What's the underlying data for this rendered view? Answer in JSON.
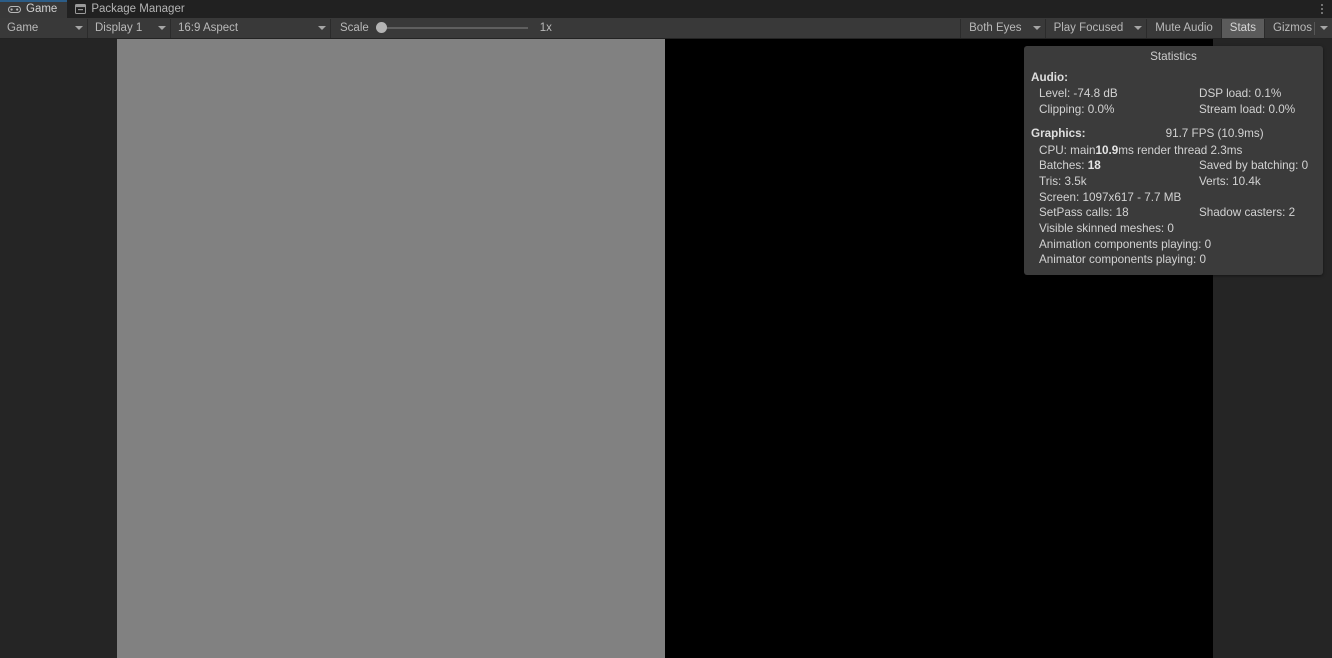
{
  "window": {
    "tabs": [
      {
        "label": "Game",
        "icon": "gamepad-icon",
        "active": true
      },
      {
        "label": "Package Manager",
        "icon": "package-icon",
        "active": false
      }
    ],
    "menu_icon": "kebab-menu-icon"
  },
  "toolbar": {
    "game_select": "Game",
    "display_select": "Display 1",
    "aspect_select": "16:9 Aspect",
    "scale_label": "Scale",
    "scale_value": "1x",
    "eyes_select": "Both Eyes",
    "play_mode_select": "Play Focused",
    "mute_audio": "Mute Audio",
    "stats": "Stats",
    "gizmos": "Gizmos"
  },
  "statistics": {
    "title": "Statistics",
    "audio": {
      "heading": "Audio:",
      "level": "Level: -74.8 dB",
      "dsp_load": "DSP load: 0.1%",
      "clipping": "Clipping: 0.0%",
      "stream_load": "Stream load: 0.0%"
    },
    "graphics": {
      "heading": "Graphics:",
      "fps": "91.7 FPS (10.9ms)",
      "cpu_prefix": "CPU: main ",
      "cpu_main_value": "10.9",
      "cpu_main_suffix": "ms  render thread 2.3ms",
      "batches_label": "Batches: ",
      "batches_value": "18",
      "saved_by_batching": "Saved by batching: 0",
      "tris": "Tris: 3.5k",
      "verts": "Verts: 10.4k",
      "screen": "Screen: 1097x617 - 7.7 MB",
      "setpass": "SetPass calls: 18",
      "shadow_casters": "Shadow casters: 2",
      "visible_skinned_meshes": "Visible skinned meshes: 0",
      "animation_components": "Animation components playing: 0",
      "animator_components": "Animator components playing: 0"
    }
  },
  "colors": {
    "accent_tab": "#2c5d87",
    "toolbar_bg": "#393939",
    "tabbar_bg": "#212121",
    "panel_bg": "#3b3b3b",
    "game_bg_black": "#000000",
    "game_bg_gray": "#818181",
    "editor_bg": "#252525"
  }
}
